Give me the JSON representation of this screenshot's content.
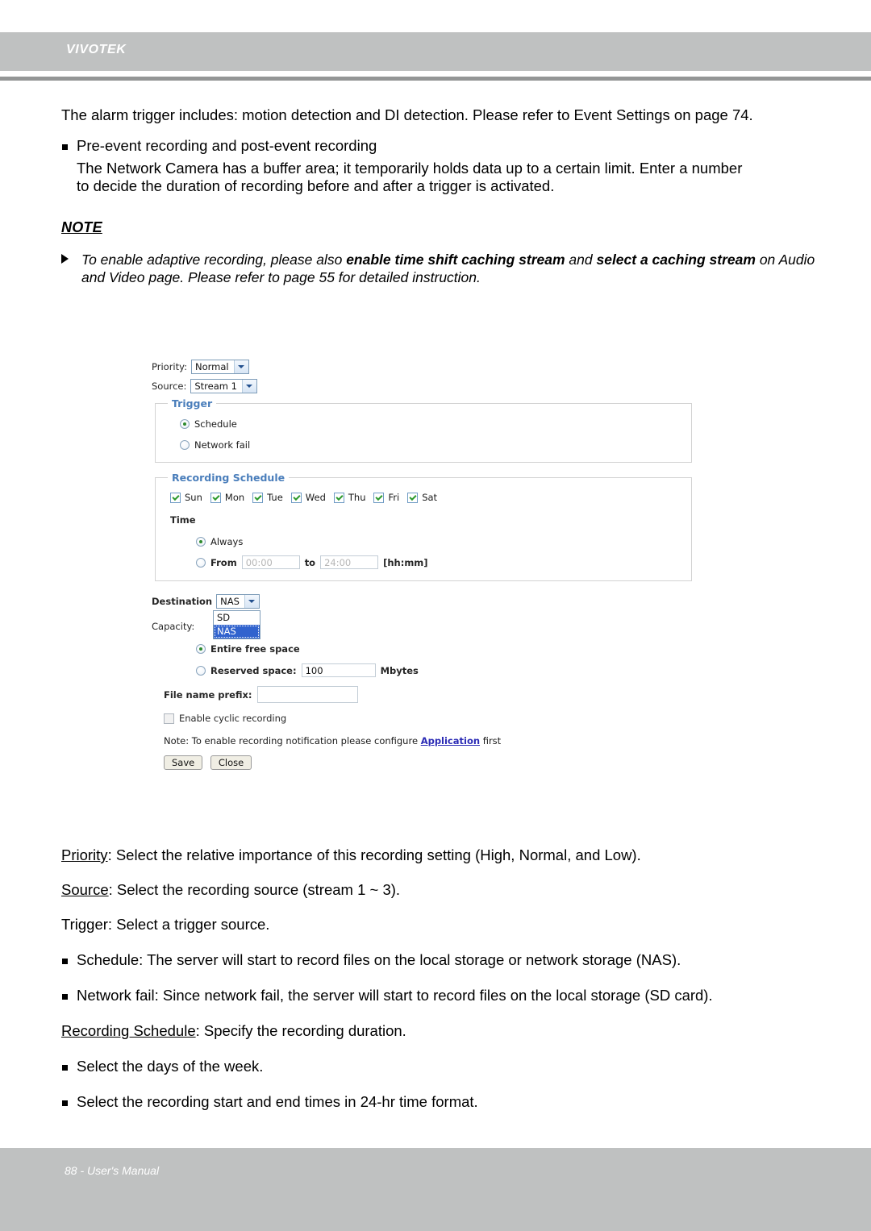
{
  "header": {
    "brand": "VIVOTEK"
  },
  "footer": {
    "text": "88 - User's Manual"
  },
  "prose": {
    "intro": "The alarm trigger includes: motion detection and DI detection. Please refer to Event Settings on page 74.",
    "bullet_pre_event": "Pre-event recording and post-event recording",
    "pre_event_line1": "The Network Camera has a buffer area; it temporarily holds data up to a certain limit. Enter a number",
    "pre_event_line2": "to decide the duration of recording before and after a trigger is activated.",
    "note_heading": "NOTE",
    "note_part1": "To enable adaptive recording, please also ",
    "note_bold1": "enable time shift caching stream",
    "note_part2": " and ",
    "note_bold2": "select a caching stream",
    "note_part3": " on Audio and Video page. Please refer to page 55 for detailed instruction."
  },
  "descriptions": {
    "priority_term": "Priority",
    "priority_text": ": Select the relative importance of this recording setting (High, Normal, and Low).",
    "source_term": "Source",
    "source_text": ": Select the recording source (stream 1 ~ 3).",
    "trigger_text": "Trigger: Select a trigger source.",
    "bullet_schedule": "Schedule: The server will start to record files on the local storage or network storage (NAS).",
    "bullet_network_fail": "Network fail: Since network fail, the server will start to record files on the local storage (SD card).",
    "rec_sched_term": "Recording Schedule",
    "rec_sched_text": ": Specify the recording duration.",
    "bullet_days": "Select the days of the week.",
    "bullet_times": "Select the recording start and end times in 24-hr time format."
  },
  "form": {
    "priority_label": "Priority:",
    "priority_value": "Normal",
    "source_label": "Source:",
    "source_value": "Stream 1",
    "trigger_legend": "Trigger",
    "trigger_schedule": "Schedule",
    "trigger_network_fail": "Network fail",
    "schedule_legend": "Recording Schedule",
    "days": [
      "Sun",
      "Mon",
      "Tue",
      "Wed",
      "Thu",
      "Fri",
      "Sat"
    ],
    "time_label": "Time",
    "time_always": "Always",
    "time_from": "From",
    "time_from_value": "00:00",
    "time_to": "to",
    "time_to_value": "24:00",
    "time_format_hint": "[hh:mm]",
    "destination_label": "Destination",
    "destination_value": "NAS",
    "destination_options": [
      "SD",
      "NAS"
    ],
    "capacity_label": "Capacity:",
    "entire_free_space": "Entire free space",
    "reserved_space": "Reserved space:",
    "reserved_space_value": "100",
    "mbytes": "Mbytes",
    "file_name_prefix": "File name prefix:",
    "file_name_prefix_value": "",
    "enable_cyclic_recording": "Enable cyclic recording",
    "note_prefix": "Note: To enable recording notification please configure ",
    "note_link": "Application",
    "note_suffix": " first",
    "save_button": "Save",
    "close_button": "Close"
  },
  "colors": {
    "header_gray": "#bfc1c1",
    "legend_blue": "#4a7ebb",
    "select_highlight": "#3163ce",
    "link_blue": "#2b2bb5",
    "check_green": "#2d9a2d"
  }
}
